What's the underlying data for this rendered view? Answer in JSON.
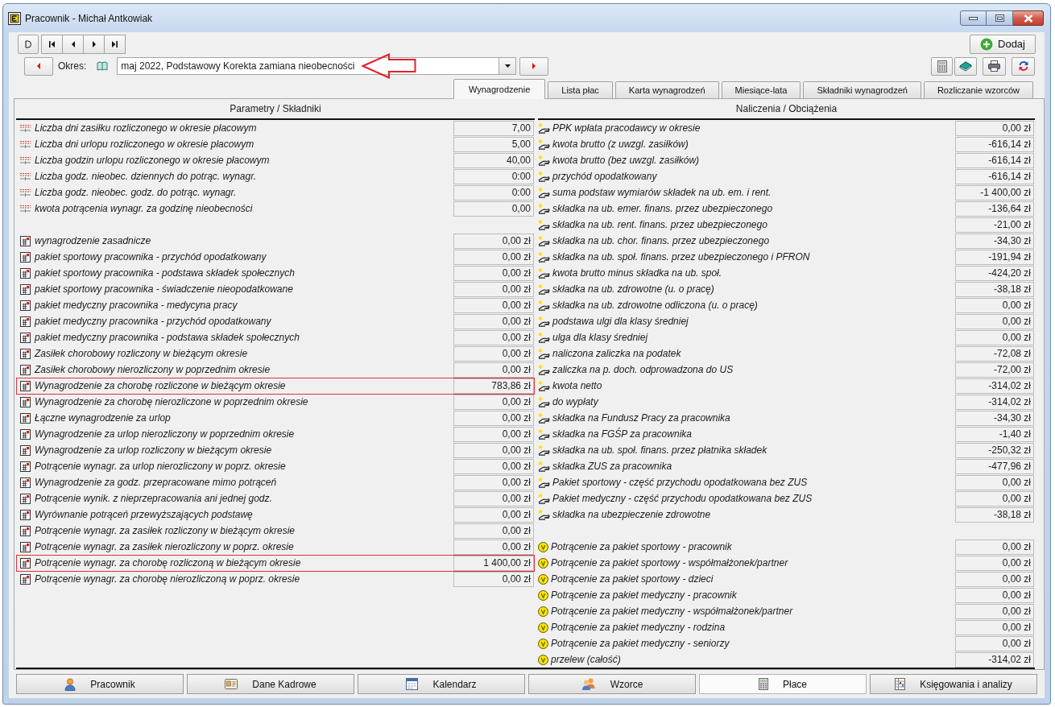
{
  "window": {
    "title": "Pracownik - Michał Antkowiak"
  },
  "toolbar": {
    "add_button": "Dodaj"
  },
  "period": {
    "label": "Okres:",
    "value": "maj 2022, Podstawowy Korekta zamiana nieobecności"
  },
  "tabs": [
    {
      "label": "Wynagrodzenie",
      "selected": true
    },
    {
      "label": "Lista płac",
      "selected": false
    },
    {
      "label": "Karta wynagrodzeń",
      "selected": false
    },
    {
      "label": "Miesiące-lata",
      "selected": false
    },
    {
      "label": "Składniki wynagrodzeń",
      "selected": false
    },
    {
      "label": "Rozliczanie wzorców",
      "selected": false
    }
  ],
  "left_panel": {
    "heading": "Parametry / Składniki",
    "groups": [
      {
        "kind": "parameter",
        "rows": [
          {
            "label": "Liczba dni zasiłku rozliczonego w okresie płacowym",
            "value": "7,00",
            "highlighted": false
          },
          {
            "label": "Liczba dni urlopu rozliczonego w okresie płacowym",
            "value": "5,00",
            "highlighted": false
          },
          {
            "label": "Liczba godzin urlopu rozliczonego w okresie płacowym",
            "value": "40,00",
            "highlighted": false
          },
          {
            "label": "Liczba godz. nieobec. dziennych do potrąc. wynagr.",
            "value": "0:00",
            "highlighted": false
          },
          {
            "label": "Liczba godz. nieobec. godz. do potrąc. wynagr.",
            "value": "0:00",
            "highlighted": false
          },
          {
            "label": "kwota potrącenia wynagr. za godzinę nieobecności",
            "value": "0,00",
            "highlighted": false
          }
        ]
      },
      {
        "kind": "component",
        "rows": [
          {
            "label": "wynagrodzenie zasadnicze",
            "value": "0,00 zł",
            "highlighted": false
          },
          {
            "label": "pakiet sportowy pracownika - przychód opodatkowany",
            "value": "0,00 zł",
            "highlighted": false
          },
          {
            "label": "pakiet sportowy pracownika - podstawa składek społecznych",
            "value": "0,00 zł",
            "highlighted": false
          },
          {
            "label": "pakiet sportowy pracownika - świadczenie nieopodatkowane",
            "value": "0,00 zł",
            "highlighted": false
          },
          {
            "label": "pakiet medyczny pracownika - medycyna pracy",
            "value": "0,00 zł",
            "highlighted": false
          },
          {
            "label": "pakiet medyczny pracownika - przychód opodatkowany",
            "value": "0,00 zł",
            "highlighted": false
          },
          {
            "label": "pakiet medyczny pracownika - podstawa składek społecznych",
            "value": "0,00 zł",
            "highlighted": false
          },
          {
            "label": "Zasiłek chorobowy rozliczony w bieżącym okresie",
            "value": "0,00 zł",
            "highlighted": false
          },
          {
            "label": "Zasiłek chorobowy nierozliczony w poprzednim okresie",
            "value": "0,00 zł",
            "highlighted": false
          },
          {
            "label": "Wynagrodzenie za chorobę rozliczone w bieżącym okresie",
            "value": "783,86 zł",
            "highlighted": true
          },
          {
            "label": "Wynagrodzenie za chorobę nierozliczone w poprzednim okresie",
            "value": "0,00 zł",
            "highlighted": false
          },
          {
            "label": "Łączne wynagrodzenie za urlop",
            "value": "0,00 zł",
            "highlighted": false
          },
          {
            "label": "Wynagrodzenie za urlop nierozliczony w poprzednim okresie",
            "value": "0,00 zł",
            "highlighted": false
          },
          {
            "label": "Wynagrodzenie za urlop rozliczony w bieżącym okresie",
            "value": "0,00 zł",
            "highlighted": false
          },
          {
            "label": "Potrącenie wynagr. za urlop nierozliczony w poprz. okresie",
            "value": "0,00 zł",
            "highlighted": false
          },
          {
            "label": "Wynagrodzenie za godz. przepracowane mimo potrąceń",
            "value": "0,00 zł",
            "highlighted": false
          },
          {
            "label": "Potrącenie wynik. z nieprzepracowania ani jednej godz.",
            "value": "0,00 zł",
            "highlighted": false
          },
          {
            "label": "Wyrównanie potrąceń przewyższających podstawę",
            "value": "0,00 zł",
            "highlighted": false
          },
          {
            "label": "Potrącenie wynagr. za zasiłek rozliczony w bieżącym okresie",
            "value": "0,00 zł",
            "highlighted": false
          },
          {
            "label": "Potrącenie wynagr. za zasiłek nierozliczony w poprz. okresie",
            "value": "0,00 zł",
            "highlighted": false
          },
          {
            "label": "Potrącenie wynagr. za chorobę rozliczoną w bieżącym okresie",
            "value": "1 400,00 zł",
            "highlighted": true
          },
          {
            "label": "Potrącenie wynagr. za chorobę nierozliczoną w poprz. okresie",
            "value": "0,00 zł",
            "highlighted": false
          }
        ]
      }
    ]
  },
  "right_panel": {
    "heading": "Naliczenia / Obciążenia",
    "groups": [
      {
        "kind": "charge",
        "rows": [
          {
            "label": "PPK wpłata pracodawcy w okresie",
            "value": "0,00 zł"
          },
          {
            "label": "kwota brutto (z uwzgl. zasiłków)",
            "value": "-616,14 zł"
          },
          {
            "label": "kwota brutto (bez uwzgl. zasiłków)",
            "value": "-616,14 zł"
          },
          {
            "label": "przychód opodatkowany",
            "value": "-616,14 zł"
          },
          {
            "label": "suma podstaw wymiarów składek na ub. em. i rent.",
            "value": "-1 400,00 zł"
          },
          {
            "label": "składka na ub. emer. finans. przez ubezpieczonego",
            "value": "-136,64 zł"
          },
          {
            "label": "składka na ub. rent. finans. przez ubezpieczonego",
            "value": "-21,00 zł"
          },
          {
            "label": "składka na ub. chor. finans. przez ubezpieczonego",
            "value": "-34,30 zł"
          },
          {
            "label": "składka na ub. społ. finans. przez ubezpieczonego i PFRON",
            "value": "-191,94 zł"
          },
          {
            "label": "kwota brutto minus składka na ub. społ.",
            "value": "-424,20 zł"
          },
          {
            "label": "składka na ub. zdrowotne (u. o pracę)",
            "value": "-38,18 zł"
          },
          {
            "label": "składka na ub. zdrowotne odliczona (u. o pracę)",
            "value": "0,00 zł"
          },
          {
            "label": "podstawa ulgi dla klasy średniej",
            "value": "0,00 zł"
          },
          {
            "label": "ulga dla klasy średniej",
            "value": "0,00 zł"
          },
          {
            "label": "naliczona zaliczka na podatek",
            "value": "-72,08 zł"
          },
          {
            "label": "zaliczka na p. doch. odprowadzona do US",
            "value": "-72,00 zł"
          },
          {
            "label": "kwota netto",
            "value": "-314,02 zł"
          },
          {
            "label": "do wypłaty",
            "value": "-314,02 zł"
          },
          {
            "label": "składka na Fundusz Pracy za pracownika",
            "value": "-34,30 zł"
          },
          {
            "label": "składka na FGŚP za pracownika",
            "value": "-1,40 zł"
          },
          {
            "label": "składka na ub. społ. finans. przez płatnika składek",
            "value": "-250,32 zł"
          },
          {
            "label": "składka ZUS za pracownika",
            "value": "-477,96 zł"
          },
          {
            "label": "Pakiet sportowy - część przychodu opodatkowana bez ZUS",
            "value": "0,00 zł"
          },
          {
            "label": "Pakiet medyczny - część przychodu opodatkowana bez ZUS",
            "value": "0,00 zł"
          },
          {
            "label": "składka na ubezpieczenie zdrowotne",
            "value": "-38,18 zł"
          }
        ]
      },
      {
        "kind": "deduction",
        "rows": [
          {
            "label": "Potrącenie za pakiet sportowy - pracownik",
            "value": "0,00 zł"
          },
          {
            "label": "Potrącenie za pakiet sportowy - współmałżonek/partner",
            "value": "0,00 zł"
          },
          {
            "label": "Potrącenie za pakiet sportowy - dzieci",
            "value": "0,00 zł"
          },
          {
            "label": "Potrącenie za pakiet medyczny - pracownik",
            "value": "0,00 zł"
          },
          {
            "label": "Potrącenie za pakiet medyczny - współmałżonek/partner",
            "value": "0,00 zł"
          },
          {
            "label": "Potrącenie za pakiet medyczny - rodzina",
            "value": "0,00 zł"
          },
          {
            "label": "Potrącenie za pakiet medyczny - seniorzy",
            "value": "0,00 zł"
          },
          {
            "label": "przelew (całość)",
            "value": "-314,02 zł"
          }
        ]
      }
    ]
  },
  "bottom_tabs": [
    {
      "label": "Pracownik",
      "kind": "person",
      "selected": false
    },
    {
      "label": "Dane Kadrowe",
      "kind": "card",
      "selected": false
    },
    {
      "label": "Kalendarz",
      "kind": "calendar",
      "selected": false
    },
    {
      "label": "Wzorce",
      "kind": "group",
      "selected": false
    },
    {
      "label": "Płace",
      "kind": "calculator",
      "selected": true
    },
    {
      "label": "Księgowania i analizy",
      "kind": "ledger",
      "selected": false
    }
  ]
}
